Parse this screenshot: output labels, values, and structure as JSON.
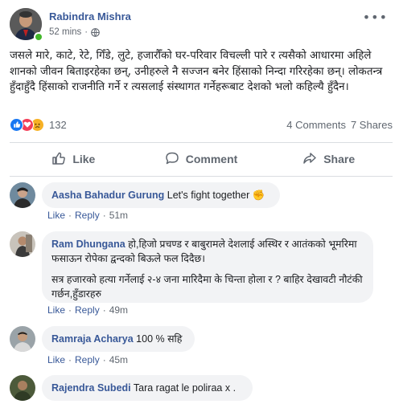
{
  "post": {
    "author": "Rabindra Mishra",
    "time": "52 mins",
    "separator": "·",
    "text": "जसले मारे, काटे, रेटे, गिँडे, लुटे, हजारौँको घर-परिवार विचल्ली पारे र त्यसैको आधारमा अहिले शानको जीवन बिताइरहेका छन्, उनीहरुले नै सज्जन बनेर हिंसाको निन्दा गरिरहेका छन्। लोकतन्त्र हुँदाहुँदै हिंसाको राजनीति गर्ने र त्यसलाई संस्थागत गर्नेहरूबाट देशको भलो कहिल्यै हुँदैन।",
    "reaction_count": "132",
    "comments_count": "4 Comments",
    "shares_count": "7 Shares"
  },
  "actions": {
    "like": "Like",
    "comment": "Comment",
    "share": "Share"
  },
  "comments": [
    {
      "name": "Aasha Bahadur Gurung",
      "text": "Let's fight together",
      "emoji": "✊",
      "like": "Like",
      "reply": "Reply",
      "time": "51m"
    },
    {
      "name": "Ram Dhungana",
      "text": "हो,हिजो प्रचण्ड र बाबुरामले देशलाई अस्थिर र आतंकको भूमरिमा फसाऊन रोपेका द्वन्दको बिऊले फल दिदैछ।",
      "text2": "सत्र हजारको हत्या गर्नेलाई २-४ जना मारिदैमा के चिन्ता होला र ? बाहिर देखावटी नौटंकी गर्छन,हुँडारहरु",
      "like": "Like",
      "reply": "Reply",
      "time": "49m"
    },
    {
      "name": "Ramraja Acharya",
      "text": "100 % सहि",
      "like": "Like",
      "reply": "Reply",
      "time": "45m"
    },
    {
      "name": "Rajendra Subedi",
      "text": "Tara ragat le poliraa x ."
    }
  ],
  "colors": {
    "name_blue": "#385898",
    "like_blue": "#1877f2",
    "love_red": "#f33e58",
    "sad_yellow": "#f7b125",
    "online_green": "#42b72a"
  },
  "icons": {
    "more": "ellipsis-icon",
    "privacy": "globe-icon"
  }
}
